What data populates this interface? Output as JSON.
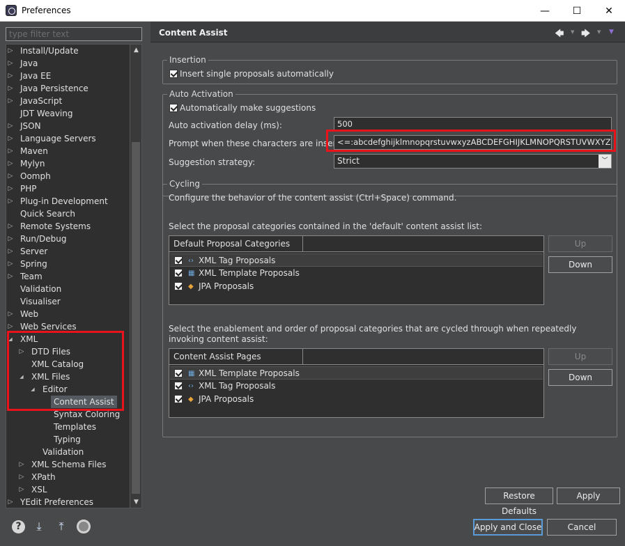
{
  "window": {
    "title": "Preferences",
    "minimize": "—",
    "maximize": "☐",
    "close": "✕"
  },
  "filter": {
    "placeholder": "type filter text"
  },
  "tree": {
    "items": [
      {
        "label": "Install/Update",
        "arrow": "▷"
      },
      {
        "label": "Java",
        "arrow": "▷"
      },
      {
        "label": "Java EE",
        "arrow": "▷"
      },
      {
        "label": "Java Persistence",
        "arrow": "▷"
      },
      {
        "label": "JavaScript",
        "arrow": "▷"
      },
      {
        "label": "JDT Weaving",
        "arrow": ""
      },
      {
        "label": "JSON",
        "arrow": "▷"
      },
      {
        "label": "Language Servers",
        "arrow": "▷"
      },
      {
        "label": "Maven",
        "arrow": "▷"
      },
      {
        "label": "Mylyn",
        "arrow": "▷"
      },
      {
        "label": "Oomph",
        "arrow": "▷"
      },
      {
        "label": "PHP",
        "arrow": "▷"
      },
      {
        "label": "Plug-in Development",
        "arrow": "▷"
      },
      {
        "label": "Quick Search",
        "arrow": ""
      },
      {
        "label": "Remote Systems",
        "arrow": "▷"
      },
      {
        "label": "Run/Debug",
        "arrow": "▷"
      },
      {
        "label": "Server",
        "arrow": "▷"
      },
      {
        "label": "Spring",
        "arrow": "▷"
      },
      {
        "label": "Team",
        "arrow": "▷"
      },
      {
        "label": "Validation",
        "arrow": ""
      },
      {
        "label": "Visualiser",
        "arrow": ""
      },
      {
        "label": "Web",
        "arrow": "▷"
      },
      {
        "label": "Web Services",
        "arrow": "▷"
      },
      {
        "label": "XML",
        "arrow": "◢"
      },
      {
        "label": "DTD Files",
        "arrow": "▷"
      },
      {
        "label": "XML Catalog",
        "arrow": ""
      },
      {
        "label": "XML Files",
        "arrow": "◢"
      },
      {
        "label": "Editor",
        "arrow": "◢"
      },
      {
        "label": "Content Assist",
        "arrow": ""
      },
      {
        "label": "Syntax Coloring",
        "arrow": ""
      },
      {
        "label": "Templates",
        "arrow": ""
      },
      {
        "label": "Typing",
        "arrow": ""
      },
      {
        "label": "Validation",
        "arrow": ""
      },
      {
        "label": "XML Schema Files",
        "arrow": "▷"
      },
      {
        "label": "XPath",
        "arrow": "▷"
      },
      {
        "label": "XSL",
        "arrow": "▷"
      },
      {
        "label": "YEdit Preferences",
        "arrow": "▷"
      }
    ]
  },
  "page": {
    "title": "Content Assist",
    "nav": {
      "back": "🡄",
      "forward": "🡆",
      "menu": "▼",
      "dd": "▼"
    }
  },
  "insertion": {
    "title": "Insertion",
    "insert_single_label": "Insert single proposals automatically"
  },
  "auto_activation": {
    "title": "Auto Activation",
    "auto_suggest_label": "Automatically make suggestions",
    "delay_label": "Auto activation delay (ms):",
    "delay_value": "500",
    "prompt_label": "Prompt when these characters are inserted:",
    "prompt_value": "<=:abcdefghijklmnopqrstuvwxyzABCDEFGHIJKLMNOPQRSTUVWXYZ",
    "strategy_label": "Suggestion strategy:",
    "strategy_value": "Strict"
  },
  "cycling": {
    "title": "Cycling",
    "description": "Configure the behavior of the content assist (Ctrl+Space) command.",
    "default_list_label": "Select the proposal categories contained in the 'default' content assist list:",
    "default_table_header": "Default Proposal Categories",
    "default_rows": [
      {
        "label": "XML Tag Proposals",
        "icon": "‹›"
      },
      {
        "label": "XML Template Proposals",
        "icon": "▦"
      },
      {
        "label": "JPA Proposals",
        "icon": "◆"
      }
    ],
    "cycle_label": "Select the enablement and order of proposal categories that are cycled through when repeatedly invoking content assist:",
    "pages_table_header": "Content Assist Pages",
    "pages_rows": [
      {
        "label": "XML Template Proposals",
        "icon": "▦"
      },
      {
        "label": "XML Tag Proposals",
        "icon": "‹›"
      },
      {
        "label": "JPA Proposals",
        "icon": "◆"
      }
    ],
    "up_label": "Up",
    "down_label": "Down"
  },
  "buttons": {
    "restore_defaults": "Restore Defaults",
    "apply": "Apply",
    "apply_and_close": "Apply and Close",
    "cancel": "Cancel"
  },
  "colors": {
    "highlight": "#e8131b",
    "accent": "#5a9bd5"
  }
}
